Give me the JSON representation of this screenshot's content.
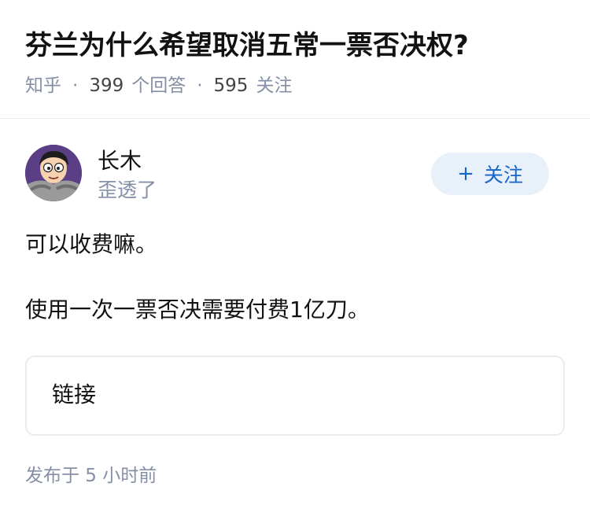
{
  "question": {
    "title": "芬兰为什么希望取消五常一票否决权?",
    "source": "知乎",
    "answer_count": "399",
    "answer_label": "个回答",
    "follower_count": "595",
    "follower_label": "关注"
  },
  "author": {
    "name": "长木",
    "headline": "歪透了",
    "follow_icon": "+",
    "follow_label": "关注"
  },
  "answer": {
    "paragraphs": [
      "可以收费嘛。",
      "使用一次一票否决需要付费1亿刀。"
    ],
    "link_card_label": "链接"
  },
  "footer": {
    "published": "发布于  5 小时前"
  },
  "colors": {
    "accent": "#1765c9",
    "follow_bg": "#e8f0fa",
    "muted": "#8590a6"
  }
}
